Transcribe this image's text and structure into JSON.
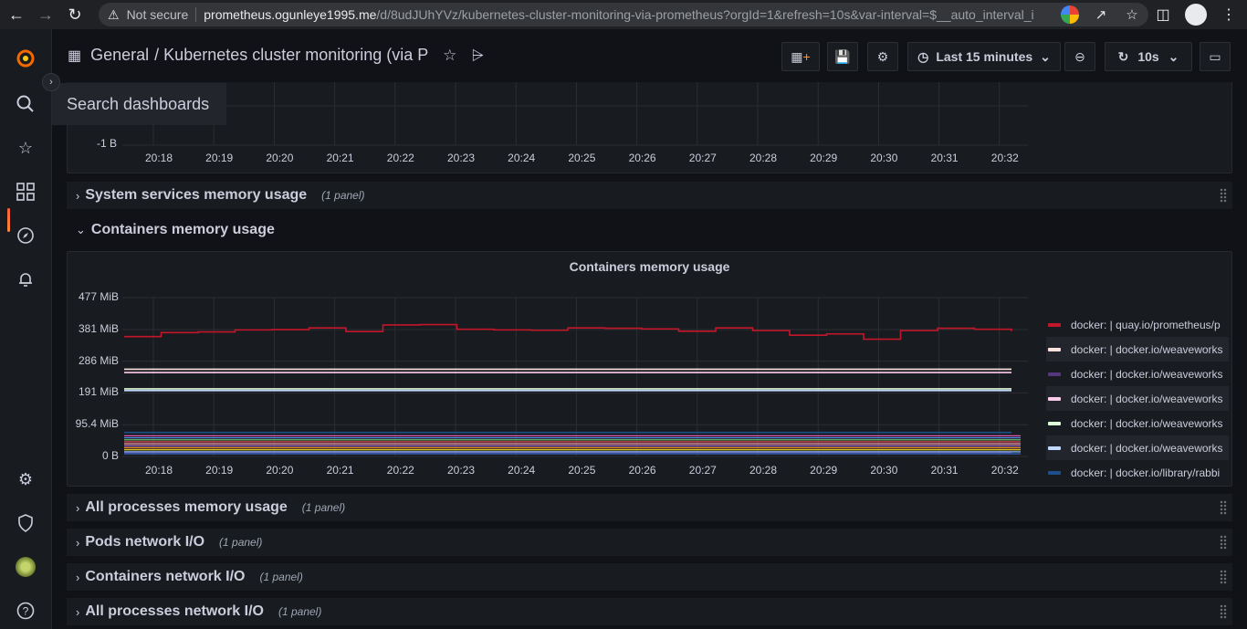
{
  "browser": {
    "not_secure": "Not secure",
    "url_host": "prometheus.ogunleye1995.me",
    "url_path": "/d/8udJUhYVz/kubernetes-cluster-monitoring-via-prometheus?orgId=1&refresh=10s&var-interval=$__auto_interval_i..."
  },
  "sidebar": {
    "search_tooltip": "Search dashboards"
  },
  "topnav": {
    "folder": "General",
    "title": "/ Kubernetes cluster monitoring (via Pr...",
    "time_range": "Last 15 minutes",
    "refresh_interval": "10s"
  },
  "top_panel": {
    "y_tick": "-1 B",
    "x_ticks": [
      "20:18",
      "20:19",
      "20:20",
      "20:21",
      "20:22",
      "20:23",
      "20:24",
      "20:25",
      "20:26",
      "20:27",
      "20:28",
      "20:29",
      "20:30",
      "20:31",
      "20:32"
    ]
  },
  "rows": {
    "system_services": {
      "title": "System services memory usage",
      "count": "(1 panel)"
    },
    "containers_memory": {
      "title": "Containers memory usage"
    },
    "all_processes_memory": {
      "title": "All processes memory usage",
      "count": "(1 panel)"
    },
    "pods_network": {
      "title": "Pods network I/O",
      "count": "(1 panel)"
    },
    "containers_network": {
      "title": "Containers network I/O",
      "count": "(1 panel)"
    },
    "all_processes_network": {
      "title": "All processes network I/O",
      "count": "(1 panel)"
    }
  },
  "chart_data": {
    "type": "line",
    "title": "Containers memory usage",
    "y_ticks": [
      "477 MiB",
      "381 MiB",
      "286 MiB",
      "191 MiB",
      "95.4 MiB",
      "0 B"
    ],
    "ylim": [
      0,
      477
    ],
    "x": [
      "20:18",
      "20:19",
      "20:20",
      "20:21",
      "20:22",
      "20:23",
      "20:24",
      "20:25",
      "20:26",
      "20:27",
      "20:28",
      "20:29",
      "20:30",
      "20:31",
      "20:32"
    ],
    "legend_position": "right",
    "series": [
      {
        "name": "docker: | quay.io/prometheus/p",
        "color": "#c4162a",
        "values": [
          360,
          372,
          374,
          380,
          381,
          386,
          375,
          395,
          396,
          382,
          380,
          379,
          386,
          385,
          383,
          376,
          386,
          378,
          364,
          368,
          352,
          378,
          385,
          382,
          376
        ]
      },
      {
        "name": "docker: | docker.io/weaveworks",
        "color": "#fce2de",
        "values": [
          262,
          262,
          262,
          262,
          262,
          262,
          262,
          262,
          262,
          262,
          262,
          262,
          262,
          262,
          262,
          262,
          262,
          262,
          262,
          262,
          262,
          262,
          262,
          262,
          262
        ]
      },
      {
        "name": "docker: | docker.io/weaveworks",
        "color": "#56367d",
        "values": [
          12,
          12,
          12,
          12,
          12,
          12,
          12,
          12,
          12,
          12,
          12,
          12,
          12,
          12,
          12,
          12,
          12,
          12,
          12,
          12,
          12,
          12,
          12,
          12,
          12
        ]
      },
      {
        "name": "docker: | docker.io/weaveworks",
        "color": "#ffcbeb",
        "values": [
          252,
          252,
          252,
          252,
          252,
          252,
          252,
          252,
          252,
          252,
          252,
          252,
          252,
          252,
          252,
          252,
          252,
          252,
          252,
          252,
          252,
          252,
          252,
          252,
          252
        ]
      },
      {
        "name": "docker: | docker.io/weaveworks",
        "color": "#e0f9d7",
        "values": [
          203,
          203,
          203,
          203,
          203,
          203,
          203,
          203,
          203,
          203,
          203,
          203,
          203,
          203,
          203,
          203,
          203,
          203,
          203,
          203,
          203,
          203,
          203,
          203,
          203
        ]
      },
      {
        "name": "docker: | docker.io/weaveworks",
        "color": "#c0d8ff",
        "values": [
          198,
          198,
          198,
          198,
          198,
          198,
          198,
          198,
          198,
          198,
          198,
          198,
          198,
          198,
          198,
          198,
          198,
          198,
          198,
          198,
          198,
          198,
          198,
          198,
          198
        ]
      },
      {
        "name": "docker: | docker.io/library/rabbi",
        "color": "#1f4e8c",
        "values": [
          72,
          72,
          72,
          72,
          72,
          72,
          72,
          72,
          72,
          72,
          72,
          72,
          72,
          72,
          72,
          72,
          72,
          72,
          72,
          72,
          72,
          72,
          72,
          72,
          72
        ]
      }
    ]
  }
}
